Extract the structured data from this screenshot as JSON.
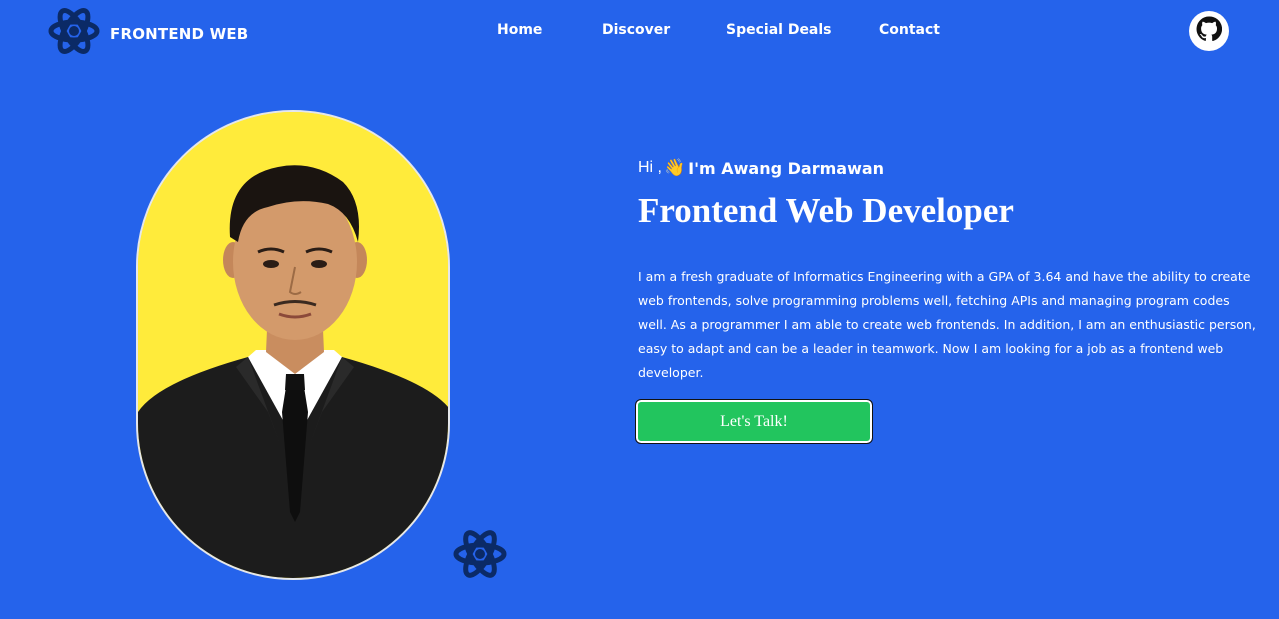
{
  "nav": {
    "brand": "FRONTEND WEB",
    "logo_icon": "react-atom-icon",
    "links": [
      {
        "label": "Home"
      },
      {
        "label": "Discover"
      },
      {
        "label": "Special Deals"
      },
      {
        "label": "Contact"
      }
    ],
    "github_icon": "github-icon"
  },
  "hero": {
    "greeting_hi": "Hi ,",
    "wave_emoji": "👋",
    "greeting_name": "I'm Awang Darmawan",
    "headline": "Frontend Web Developer",
    "bio": "I am a fresh graduate of Informatics Engineering with a GPA of 3.64 and have the ability to create web frontends, solve programming problems well, fetching APIs and managing program codes well. As a programmer I am able to create web frontends. In addition, I am an enthusiastic person, easy to adapt and can be a leader in teamwork. Now I am looking for a job as a frontend web developer.",
    "cta_label": "Let's Talk!"
  },
  "colors": {
    "background": "#2563eb",
    "portrait_bg": "#ffeb3b",
    "cta": "#22c55e",
    "atom": "#0b2a66"
  }
}
